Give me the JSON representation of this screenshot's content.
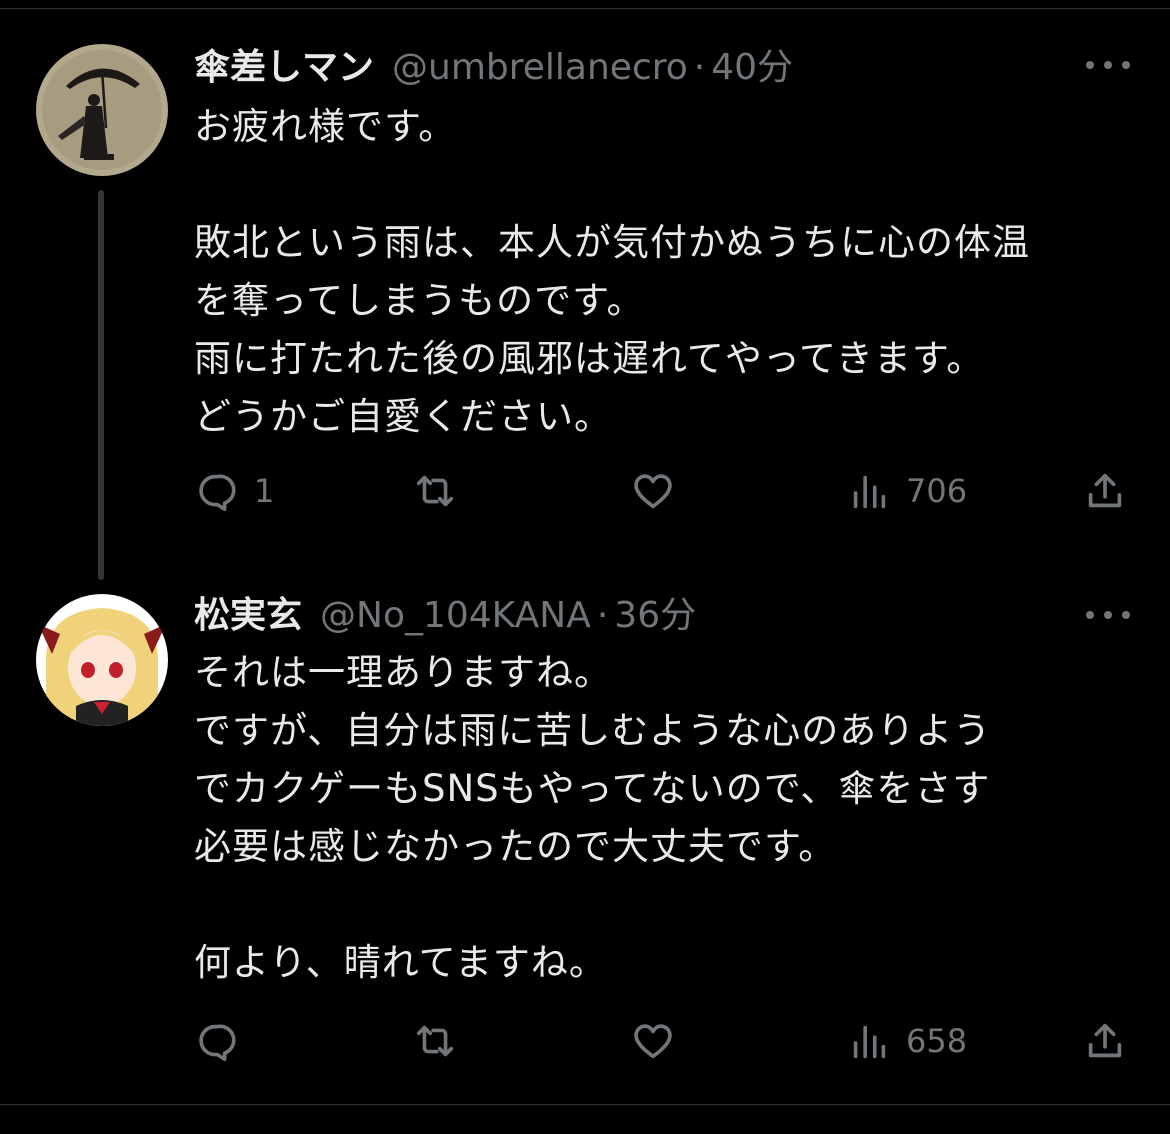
{
  "tweets": [
    {
      "display_name": "傘差しマン",
      "handle": "@umbrellanecro",
      "separator": "·",
      "time": "40分",
      "text": "お疲れ様です。\n\n敗北という雨は、本人が気付かぬうちに心の体温\nを奪ってしまうものです。\n雨に打たれた後の風邪は遅れてやってきます。\nどうかご自愛ください。",
      "reply_count": "1",
      "retweet_count": "",
      "like_count": "",
      "view_count": "706"
    },
    {
      "display_name": "松実玄",
      "handle": "@No_104KANA",
      "separator": "·",
      "time": "36分",
      "text": "それは一理ありますね。\nですが、自分は雨に苦しむような心のありよう\nでカクゲーもSNSもやってないので、傘をさす\n必要は感じなかったので大丈夫です。\n\n何より、晴れてますね。",
      "reply_count": "",
      "retweet_count": "",
      "like_count": "",
      "view_count": "658"
    }
  ],
  "icons": {
    "more": "more-horizontal-icon",
    "reply": "reply-bubble-icon",
    "retweet": "retweet-icon",
    "like": "heart-icon",
    "views": "views-bar-chart-icon",
    "share": "share-upload-icon"
  },
  "colors": {
    "background": "#000000",
    "primary_text": "#e7e9ea",
    "secondary_text": "#71767b",
    "divider": "#2f3336",
    "thread_line": "#333639"
  }
}
